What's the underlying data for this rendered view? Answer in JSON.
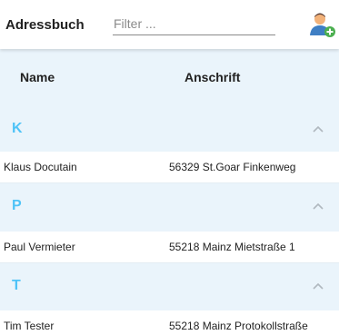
{
  "app": {
    "title": "Adressbuch"
  },
  "filter": {
    "placeholder": "Filter ...",
    "value": ""
  },
  "toolbar": {
    "add_user_icon": "add-contact-icon",
    "accent": "#4caf50"
  },
  "table": {
    "columns": {
      "name": "Name",
      "address": "Anschrift"
    },
    "letter_color": "#4fc3f7",
    "groups": [
      {
        "letter": "K",
        "collapse_icon": "chevron-up-icon",
        "rows": [
          {
            "name": "Klaus Docutain",
            "address": "56329 St.Goar Finkenweg"
          }
        ]
      },
      {
        "letter": "P",
        "collapse_icon": "chevron-up-icon",
        "rows": [
          {
            "name": "Paul Vermieter",
            "address": "55218 Mainz Mietstraße 1"
          }
        ]
      },
      {
        "letter": "T",
        "collapse_icon": "chevron-up-icon",
        "rows": [
          {
            "name": "Tim Tester",
            "address": "55218 Mainz Protokollstraße"
          }
        ]
      }
    ]
  }
}
